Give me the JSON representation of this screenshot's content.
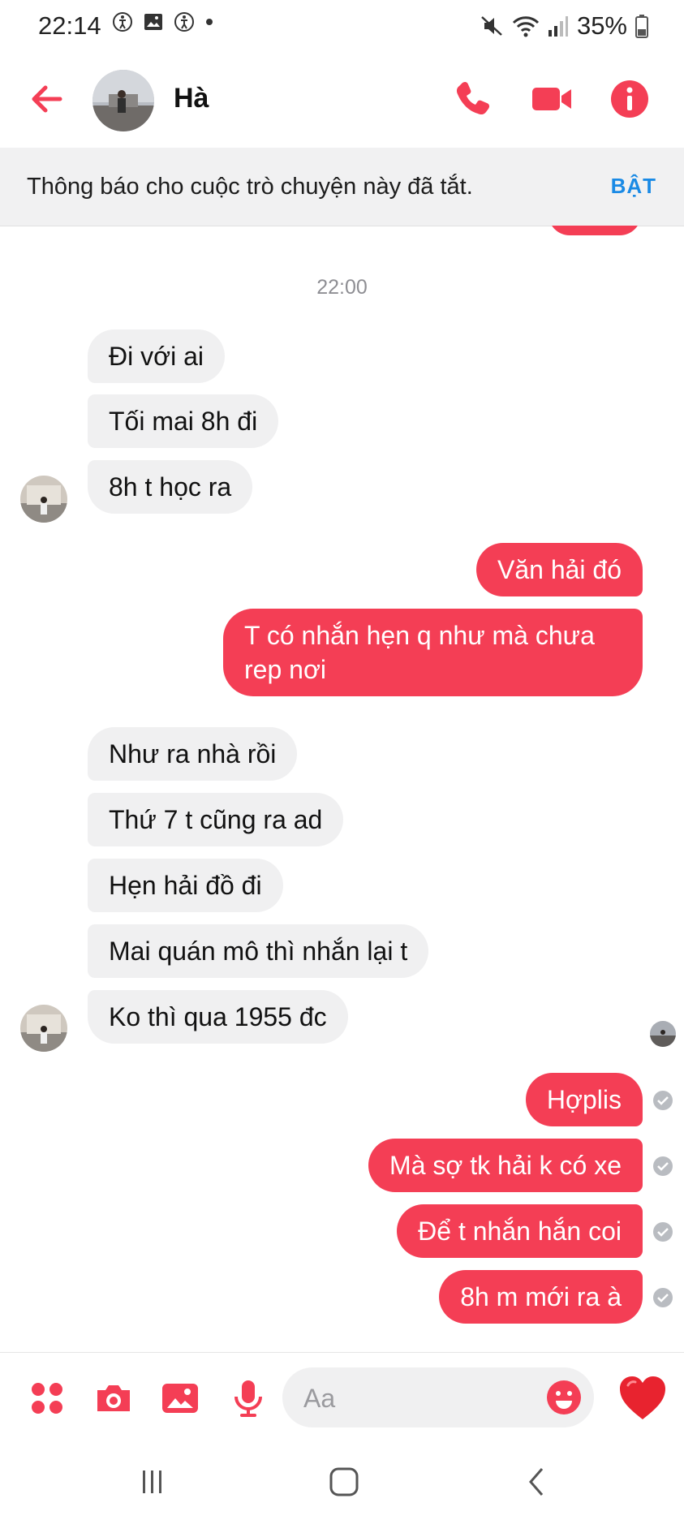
{
  "status_bar": {
    "time": "22:14",
    "battery": "35%",
    "left_icons": [
      "accessibility-icon",
      "image-icon",
      "accessibility-icon",
      "dot-icon"
    ],
    "right_icons": [
      "mute-icon",
      "wifi-icon",
      "signal-icon",
      "battery-icon"
    ]
  },
  "header": {
    "contact_name": "Hà",
    "accent_color": "#f43e55",
    "icons": [
      "back-arrow-icon",
      "phone-icon",
      "video-icon",
      "info-icon"
    ]
  },
  "notice": {
    "text": "Thông báo cho cuộc trò chuyện này đã tắt.",
    "action": "BẬT"
  },
  "chat": {
    "timestamp": "22:00",
    "messages": [
      {
        "side": "in",
        "text": "Đi với ai"
      },
      {
        "side": "in",
        "text": "Tối mai 8h đi"
      },
      {
        "side": "in",
        "text": "8h t học ra"
      },
      {
        "side": "out",
        "text": "Văn hải đó"
      },
      {
        "side": "out",
        "text": "T có nhắn hẹn q như mà chưa rep nơi"
      },
      {
        "side": "in",
        "text": "Như ra nhà rồi"
      },
      {
        "side": "in",
        "text": "Thứ 7 t cũng ra ad"
      },
      {
        "side": "in",
        "text": "Hẹn hải đồ đi"
      },
      {
        "side": "in",
        "text": "Mai quán mô thì nhắn lại t"
      },
      {
        "side": "in",
        "text": "Ko thì qua 1955 đc"
      },
      {
        "side": "out",
        "text": "Hợplis"
      },
      {
        "side": "out",
        "text": "Mà sợ tk hải k có xe"
      },
      {
        "side": "out",
        "text": "Để t nhắn hắn coi"
      },
      {
        "side": "out",
        "text": "8h m mới ra à"
      }
    ]
  },
  "composer": {
    "placeholder": "Aa",
    "icons": [
      "apps-icon",
      "camera-icon",
      "gallery-icon",
      "microphone-icon",
      "emoji-icon",
      "heart-icon"
    ]
  },
  "nav_bar": {
    "icons": [
      "recent-apps-icon",
      "home-icon",
      "back-icon"
    ]
  }
}
